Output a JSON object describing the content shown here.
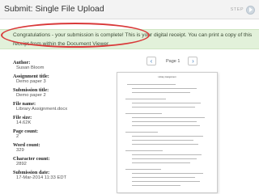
{
  "header": {
    "title": "Submit: Single File Upload",
    "step_label": "STEP"
  },
  "banner": {
    "message": "Congratulations - your submission is complete! This is your digital receipt. You can print a copy of this receipt from within the Document Viewer."
  },
  "metadata": [
    {
      "label": "Author:",
      "value": "Susan Bloom"
    },
    {
      "label": "Assignment title:",
      "value": "Demo paper 3"
    },
    {
      "label": "Submission title:",
      "value": "Demo paper 2"
    },
    {
      "label": "File name:",
      "value": "Library Assignment.docx"
    },
    {
      "label": "File size:",
      "value": "14.62K"
    },
    {
      "label": "Page count:",
      "value": "2"
    },
    {
      "label": "Word count:",
      "value": "329"
    },
    {
      "label": "Character count:",
      "value": "2892"
    },
    {
      "label": "Submission date:",
      "value": "17-Mar-2014 11:33 EDT"
    }
  ],
  "viewer": {
    "prev_icon": "‹",
    "next_icon": "›",
    "page_label": "Page 1",
    "doc_title": "Library Assignment"
  }
}
